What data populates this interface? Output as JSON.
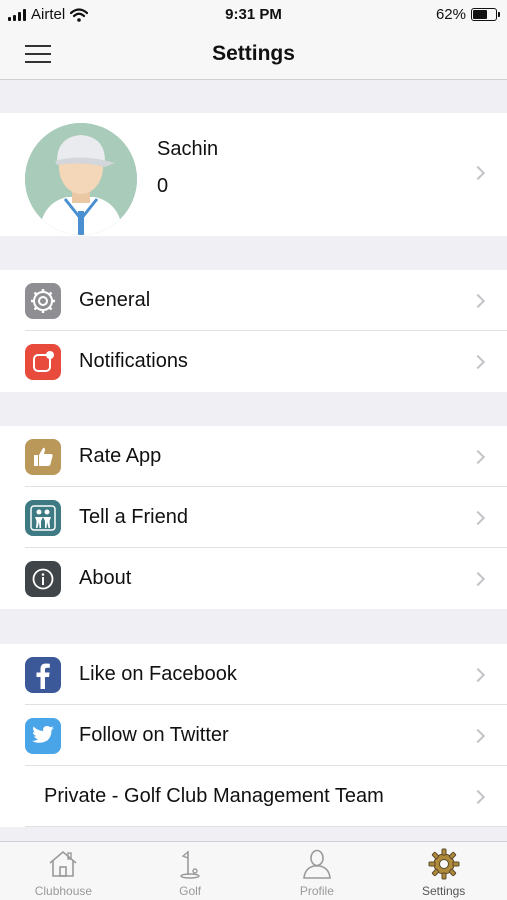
{
  "status_bar": {
    "carrier": "Airtel",
    "time": "9:31 PM",
    "battery": "62%"
  },
  "nav": {
    "title": "Settings"
  },
  "profile": {
    "name": "Sachin",
    "count": "0"
  },
  "settings": {
    "general": "General",
    "notifications": "Notifications",
    "rate_app": "Rate App",
    "tell_friend": "Tell a Friend",
    "about": "About",
    "facebook": "Like on Facebook",
    "twitter": "Follow on Twitter",
    "private": "Private - Golf Club Management Team"
  },
  "tabs": [
    {
      "label": "Clubhouse",
      "icon": "house-icon"
    },
    {
      "label": "Golf",
      "icon": "golf-flag-icon"
    },
    {
      "label": "Profile",
      "icon": "person-icon"
    },
    {
      "label": "Settings",
      "icon": "gear-icon"
    }
  ],
  "colors": {
    "general": "#8e8e93",
    "notifications": "#e84a3c",
    "rate_app": "#b9985a",
    "tell_friend": "#3d7a83",
    "about": "#3f4548",
    "facebook": "#3b5998",
    "twitter": "#4aa4e8"
  }
}
